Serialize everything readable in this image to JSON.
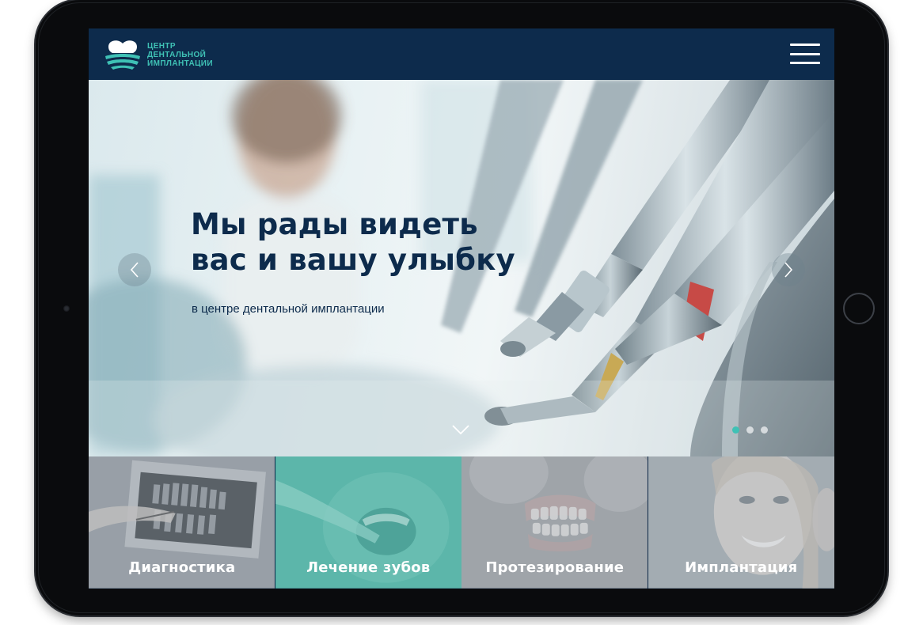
{
  "logo": {
    "lines": [
      "ЦЕНТР",
      "ДЕНТАЛЬНОЙ",
      "ИМПЛАНТАЦИИ"
    ]
  },
  "header": {
    "menu_icon": "hamburger-menu-icon"
  },
  "hero": {
    "title_line1": "Мы рады видеть",
    "title_line2": "вас и вашу улыбку",
    "subtitle": "в центре дентальной имплантации",
    "prev_icon": "chevron-left-icon",
    "next_icon": "chevron-right-icon",
    "scroll_icon": "chevron-down-icon",
    "slides_total": 3,
    "active_slide": 1
  },
  "services": [
    {
      "label": "Диагностика"
    },
    {
      "label": "Лечение зубов"
    },
    {
      "label": "Протезирование"
    },
    {
      "label": "Имплантация"
    }
  ],
  "colors": {
    "header_bg": "#0d2b4c",
    "accent": "#3fc1b5",
    "title_text": "#0d2b4c",
    "device_frame": "#0a0b0d"
  }
}
